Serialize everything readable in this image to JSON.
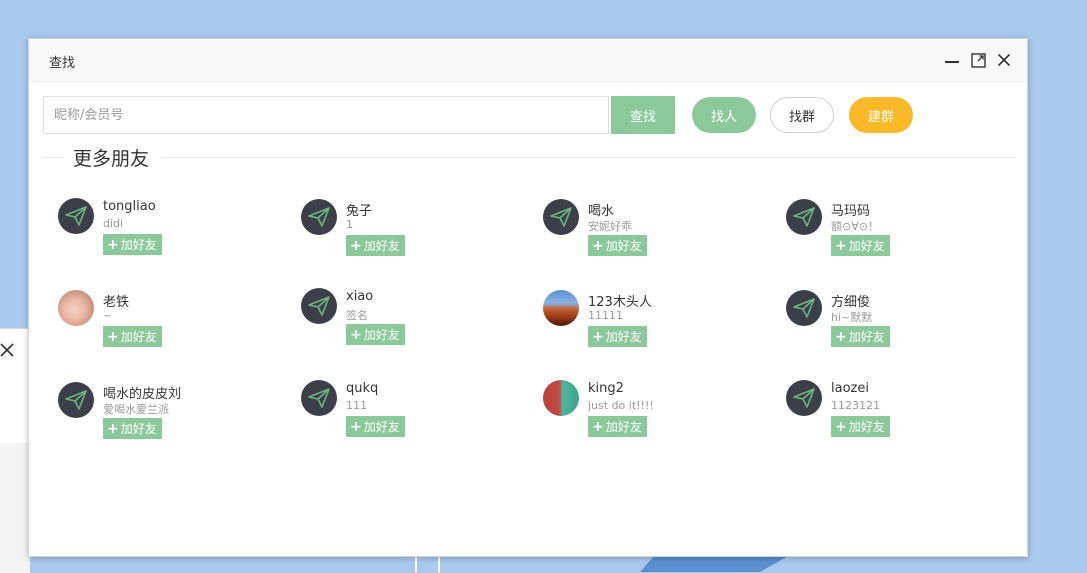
{
  "dialog": {
    "title": "查找",
    "search": {
      "placeholder": "昵称/会员号",
      "value": "",
      "button": "查找"
    },
    "filters": {
      "people": "找人",
      "groups": "找群",
      "create_group": "建群"
    },
    "section_title": "更多朋友"
  },
  "add_label": "加好友",
  "friends": [
    {
      "name": "tongliao",
      "sign": "didi",
      "avatar": "paper-plane-icon"
    },
    {
      "name": "兔子",
      "sign": "1",
      "avatar": "paper-plane-icon"
    },
    {
      "name": "喝水",
      "sign": "安妮好乖",
      "avatar": "paper-plane-icon"
    },
    {
      "name": "马玛码",
      "sign": "额⊙∀⊙！",
      "avatar": "paper-plane-icon"
    },
    {
      "name": "老铁",
      "sign": "~",
      "avatar": "photo"
    },
    {
      "name": "xiao",
      "sign": "签名",
      "avatar": "paper-plane-icon"
    },
    {
      "name": "123木头人",
      "sign": "11111",
      "avatar": "photo"
    },
    {
      "name": "方细俊",
      "sign": "hi~默默",
      "avatar": "paper-plane-icon"
    },
    {
      "name": "喝水的皮皮刘",
      "sign": "爱喝水爱兰派",
      "avatar": "paper-plane-icon"
    },
    {
      "name": "qukq",
      "sign": "111",
      "avatar": "paper-plane-icon"
    },
    {
      "name": "king2",
      "sign": "just do it!!!!",
      "avatar": "photo"
    },
    {
      "name": "laozei",
      "sign": "1123121",
      "avatar": "paper-plane-icon"
    }
  ],
  "colors": {
    "accent_green": "#8cc99a",
    "accent_yellow": "#fbb829",
    "avatar_dark": "#3c3f4a",
    "desktop_blue": "#a9c9ee"
  }
}
